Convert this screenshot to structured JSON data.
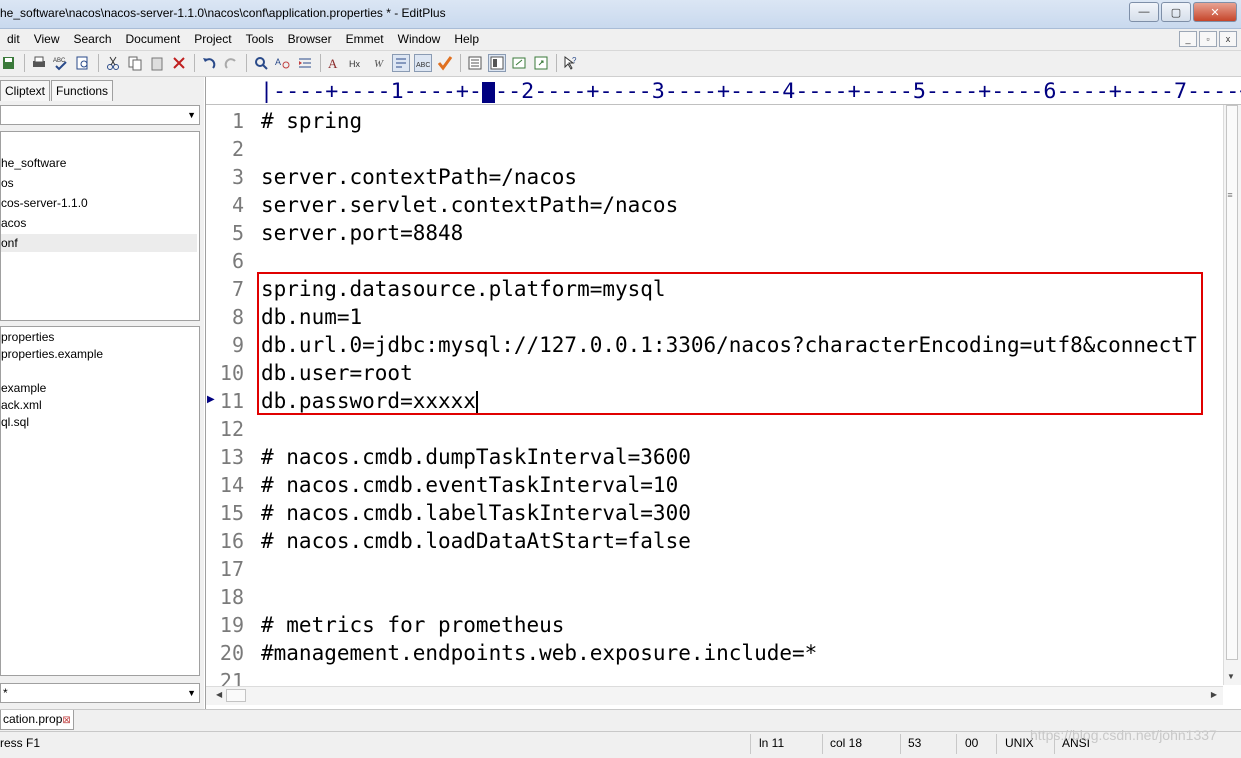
{
  "window": {
    "title": "he_software\\nacos\\nacos-server-1.1.0\\nacos\\conf\\application.properties * - EditPlus",
    "minimize_glyph": "—",
    "maximize_glyph": "▢",
    "close_glyph": "✕"
  },
  "menu": {
    "items": [
      "dit",
      "View",
      "Search",
      "Document",
      "Project",
      "Tools",
      "Browser",
      "Emmet",
      "Window",
      "Help"
    ]
  },
  "mdi_controls": [
    "_",
    "▫",
    "x"
  ],
  "toolbar": {
    "icons": [
      "save-all-icon",
      "print-icon",
      "spell-check-icon",
      "find-in-files-icon",
      "cut-icon",
      "copy-icon",
      "paste-icon",
      "delete-icon",
      "undo-icon",
      "redo-icon",
      "find-icon",
      "replace-icon",
      "indent-icon",
      "font-icon",
      "html-icon",
      "italic-icon",
      "word-wrap-icon",
      "column-mode-icon",
      "check-icon",
      "outline-icon",
      "full-screen-icon",
      "new-window-icon",
      "browser-preview-icon",
      "help-cursor-icon"
    ]
  },
  "left_panel": {
    "tabs": [
      "Cliptext",
      "Functions"
    ],
    "directory_select": "",
    "tree_items": [
      "he_software",
      "os",
      "cos-server-1.1.0",
      "acos",
      "onf"
    ],
    "tree_selected_index": 4,
    "files": [
      "properties",
      "properties.example",
      "",
      "example",
      "ack.xml",
      "ql.sql"
    ],
    "filter_select": "*"
  },
  "editor": {
    "ruler": "|----+----1----+----2----+----3----+----4----+----5----+----6----+----7----+",
    "current_line": 11,
    "lines": [
      {
        "n": "1",
        "text": "# spring"
      },
      {
        "n": "2",
        "text": ""
      },
      {
        "n": "3",
        "text": "server.contextPath=/nacos"
      },
      {
        "n": "4",
        "text": "server.servlet.contextPath=/nacos"
      },
      {
        "n": "5",
        "text": "server.port=8848"
      },
      {
        "n": "6",
        "text": ""
      },
      {
        "n": "7",
        "text": "spring.datasource.platform=mysql"
      },
      {
        "n": "8",
        "text": "db.num=1"
      },
      {
        "n": "9",
        "text": "db.url.0=jdbc:mysql://127.0.0.1:3306/nacos?characterEncoding=utf8&connectT"
      },
      {
        "n": "10",
        "text": "db.user=root"
      },
      {
        "n": "11",
        "text": "db.password=xxxxx"
      },
      {
        "n": "12",
        "text": ""
      },
      {
        "n": "13",
        "text": "# nacos.cmdb.dumpTaskInterval=3600"
      },
      {
        "n": "14",
        "text": "# nacos.cmdb.eventTaskInterval=10"
      },
      {
        "n": "15",
        "text": "# nacos.cmdb.labelTaskInterval=300"
      },
      {
        "n": "16",
        "text": "# nacos.cmdb.loadDataAtStart=false"
      },
      {
        "n": "17",
        "text": ""
      },
      {
        "n": "18",
        "text": ""
      },
      {
        "n": "19",
        "text": "# metrics for prometheus"
      },
      {
        "n": "20",
        "text": "#management.endpoints.web.exposure.include=*"
      },
      {
        "n": "21",
        "text": ""
      }
    ],
    "highlight_color": "#e00000"
  },
  "doc_tabs": [
    {
      "label": "cation.prop",
      "close": "⊠"
    }
  ],
  "status": {
    "hint": "ress F1",
    "line": "ln 11",
    "col": "col 18",
    "chars": "53",
    "code": "00",
    "eol": "UNIX",
    "encoding": "ANSI"
  },
  "watermark": "https://blog.csdn.net/john1337"
}
